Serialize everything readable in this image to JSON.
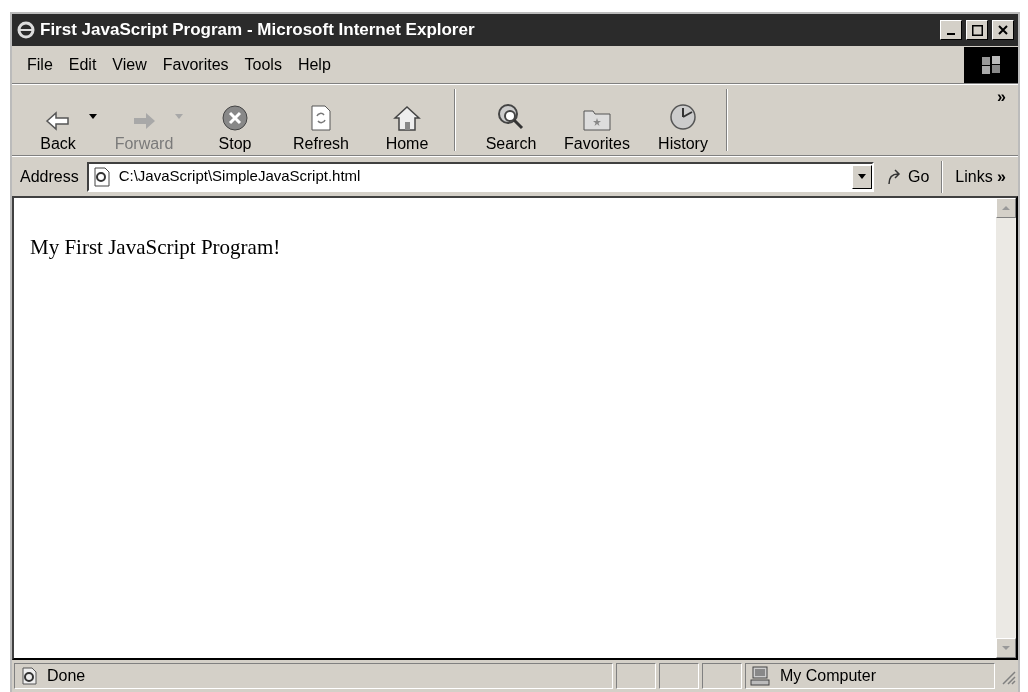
{
  "window": {
    "title": "First JavaScript Program - Microsoft Internet Explorer"
  },
  "menu": [
    "File",
    "Edit",
    "View",
    "Favorites",
    "Tools",
    "Help"
  ],
  "toolbar": [
    {
      "kind": "back",
      "label": "Back",
      "disabled": false,
      "dropdown": true
    },
    {
      "kind": "forward",
      "label": "Forward",
      "disabled": true,
      "dropdown": true
    },
    {
      "kind": "stop",
      "label": "Stop",
      "disabled": false,
      "dropdown": false
    },
    {
      "kind": "refresh",
      "label": "Refresh",
      "disabled": false,
      "dropdown": false
    },
    {
      "kind": "home",
      "label": "Home",
      "disabled": false,
      "dropdown": false
    },
    {
      "kind": "search",
      "label": "Search",
      "disabled": false,
      "dropdown": false
    },
    {
      "kind": "favorites",
      "label": "Favorites",
      "disabled": false,
      "dropdown": false
    },
    {
      "kind": "history",
      "label": "History",
      "disabled": false,
      "dropdown": false
    }
  ],
  "toolbar_more": "»",
  "address_bar": {
    "label": "Address",
    "value": "C:\\JavaScript\\SimpleJavaScript.html",
    "go": "Go",
    "links": "Links",
    "links_more": "»"
  },
  "page": {
    "text": "My First JavaScript Program!"
  },
  "status_bar": {
    "status": "Done",
    "zone": "My Computer"
  }
}
